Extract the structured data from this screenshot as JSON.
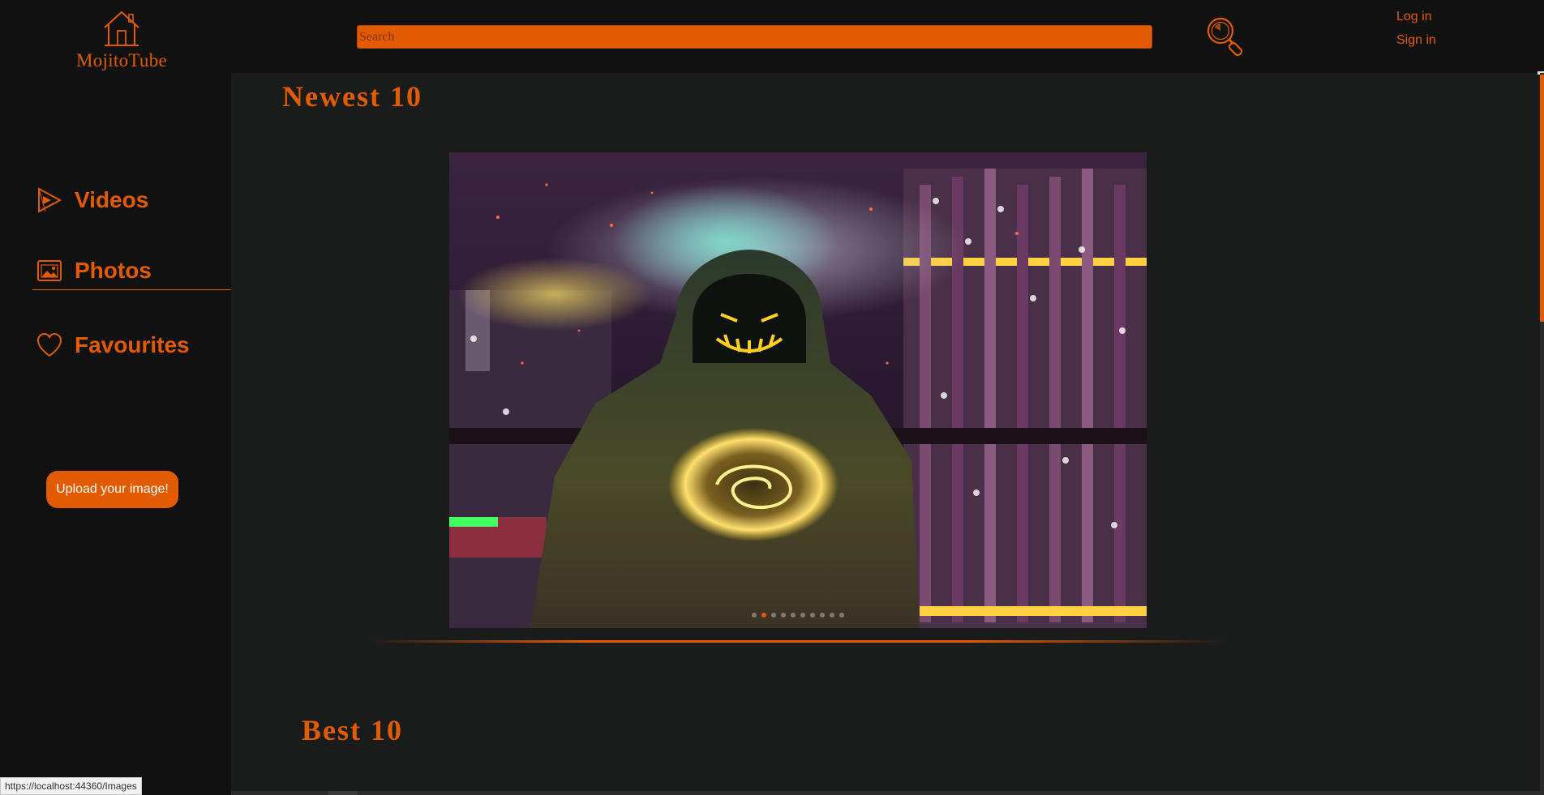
{
  "header": {
    "logo_text": "MojitoTube",
    "search_placeholder": "Search",
    "search_value": "",
    "login_label": "Log in",
    "signin_label": "Sign in"
  },
  "sidebar": {
    "items": [
      {
        "label": "Videos",
        "icon": "play-icon"
      },
      {
        "label": "Photos",
        "icon": "photo-icon",
        "active": true
      },
      {
        "label": "Favourites",
        "icon": "heart-icon"
      }
    ],
    "upload_label": "Upload your image!"
  },
  "main": {
    "newest_title": "Newest 10",
    "best_title": "Best 10",
    "carousel": {
      "image_subject": "hooded figure with glowing neon mask over city lights",
      "slide_count": 10,
      "active_slide": 1
    }
  },
  "status_url": "https://localhost:44360/Images",
  "colors": {
    "accent": "#e35b00",
    "background": "#111111",
    "main_background": "#1a1c1b"
  }
}
